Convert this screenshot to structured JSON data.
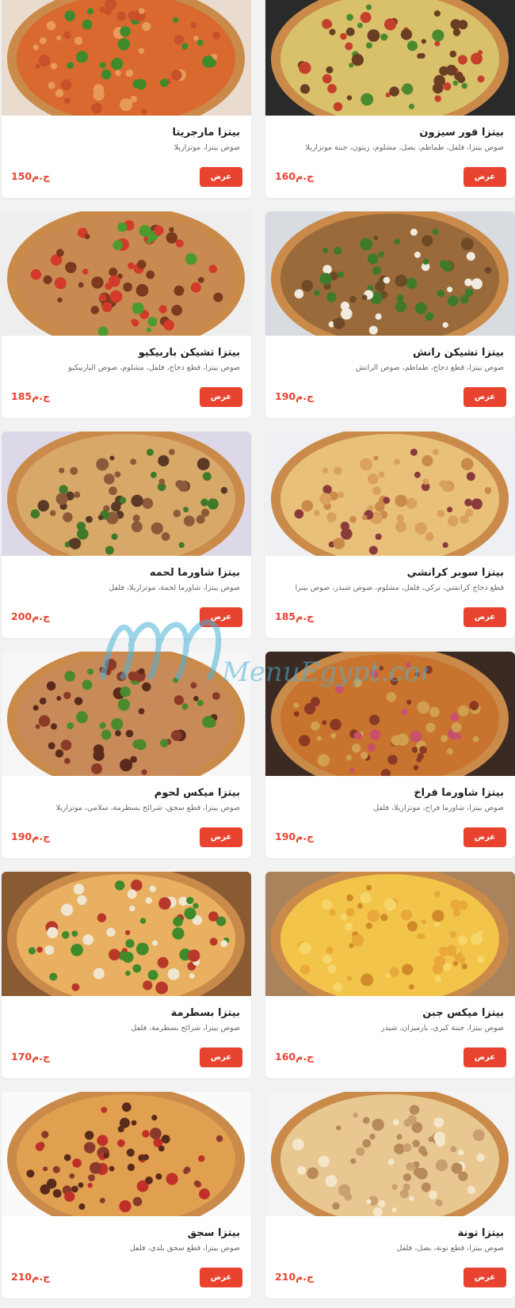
{
  "currency": "ج.م",
  "view_label": "عرض",
  "watermark_text": "MenuEgypt.com",
  "items": [
    {
      "name": "بيتزا فور سيزون",
      "desc": "صوص بيتزا، فلفل، طماطم، بصل، مشلوم، زيتون، جبنة موتزاريلا",
      "price": "160",
      "price_text": "160ج.م",
      "image_icon": "pizza-four-seasons-photo"
    },
    {
      "name": "بيتزا مارجريتا",
      "desc": "صوص بيتزا، موتزاريلا",
      "price": "150",
      "price_text": "150ج.م",
      "image_icon": "pizza-margherita-photo"
    },
    {
      "name": "بيتزا تشيكن رانش",
      "desc": "صوص بيتزا، قطع دجاج، طماطم، صوص الرانش",
      "price": "190",
      "price_text": "190ج.م",
      "image_icon": "pizza-chicken-ranch-photo"
    },
    {
      "name": "بيتزا تشيكن باربيكيو",
      "desc": "صوص بيتزا، قطع دجاج، فلفل، مشلوم، صوص الباربيكيو",
      "price": "185",
      "price_text": "185ج.م",
      "image_icon": "pizza-chicken-bbq-photo"
    },
    {
      "name": "بيتزا سوبر كرانشي",
      "desc": "قطع دجاج كرانشي، تركي، فلفل، مشلوم، صوص شيدر، صوص بيتزا",
      "price": "185",
      "price_text": "185ج.م",
      "image_icon": "pizza-super-crunchy-photo"
    },
    {
      "name": "بيتزا شاورما لحمه",
      "desc": "صوص بيتزا، شاورما لحمة، موتزاريلا، فلفل",
      "price": "200",
      "price_text": "200ج.م",
      "image_icon": "pizza-meat-shawarma-photo"
    },
    {
      "name": "بيتزا شاورما فراخ",
      "desc": "صوص بيتزا، شاورما فراخ، موتزاريلا، فلفل",
      "price": "190",
      "price_text": "190ج.م",
      "image_icon": "pizza-chicken-shawarma-photo"
    },
    {
      "name": "بيتزا ميكس لحوم",
      "desc": "صوص بيتزا، قطع سجق، شرائح بسطرمة، سلامي، موتزاريلا",
      "price": "190",
      "price_text": "190ج.م",
      "image_icon": "pizza-mixed-meat-photo"
    },
    {
      "name": "بيتزا ميكس جبن",
      "desc": "صوص بيتزا، جبنة كيري، بارميزان، شيدر",
      "price": "160",
      "price_text": "160ج.م",
      "image_icon": "pizza-mixed-cheese-photo"
    },
    {
      "name": "بيتزا بسطرمة",
      "desc": "صوص بيتزا، شرائح بسطرمة، فلفل",
      "price": "170",
      "price_text": "170ج.م",
      "image_icon": "pizza-pastrami-photo"
    },
    {
      "name": "بيتزا تونة",
      "desc": "صوص بيتزا، قطع تونة، بصل، فلفل",
      "price": "210",
      "price_text": "210ج.م",
      "image_icon": "pizza-tuna-photo"
    },
    {
      "name": "بيتزا سجق",
      "desc": "صوص بيتزا، قطع سجق بلدي، فلفل",
      "price": "210",
      "price_text": "210ج.م",
      "image_icon": "pizza-sausage-photo"
    }
  ],
  "colors": {
    "accent": "#e8432f",
    "background": "#f2f2f2",
    "card": "#ffffff"
  }
}
